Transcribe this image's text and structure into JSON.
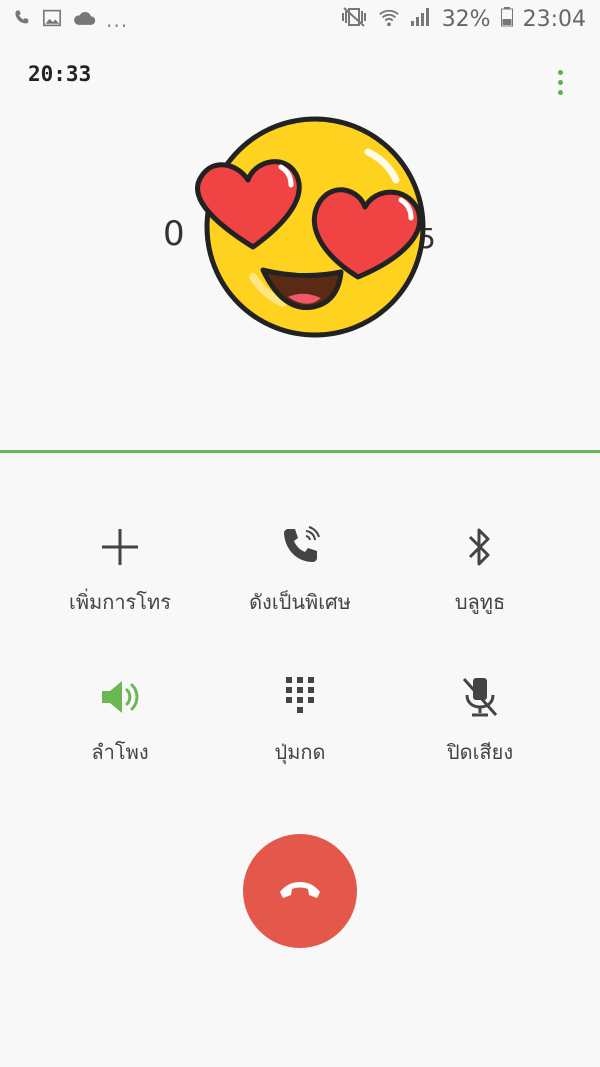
{
  "status_bar": {
    "left_icons": [
      "phone-icon",
      "image-icon",
      "cloud-icon"
    ],
    "overflow": "...",
    "right_icons": [
      "mute-vibrate-icon",
      "wifi-icon",
      "signal-icon"
    ],
    "battery": "32%",
    "time": "23:04"
  },
  "call": {
    "timer": "20:33",
    "number_head": "0",
    "number_tail": "5"
  },
  "actions": [
    {
      "label": "เพิ่มการโทร",
      "icon": "plus-icon"
    },
    {
      "label": "ดังเป็นพิเศษ",
      "icon": "phone-volume-icon"
    },
    {
      "label": "บลูทูธ",
      "icon": "bluetooth-icon"
    },
    {
      "label": "ลำโพง",
      "icon": "speaker-icon"
    },
    {
      "label": "ปุ่มกด",
      "icon": "keypad-icon"
    },
    {
      "label": "ปิดเสียง",
      "icon": "mic-off-icon"
    }
  ],
  "colors": {
    "accent": "#6ab853",
    "end_call": "#e4574b",
    "speaker_active": "#6ab853"
  }
}
